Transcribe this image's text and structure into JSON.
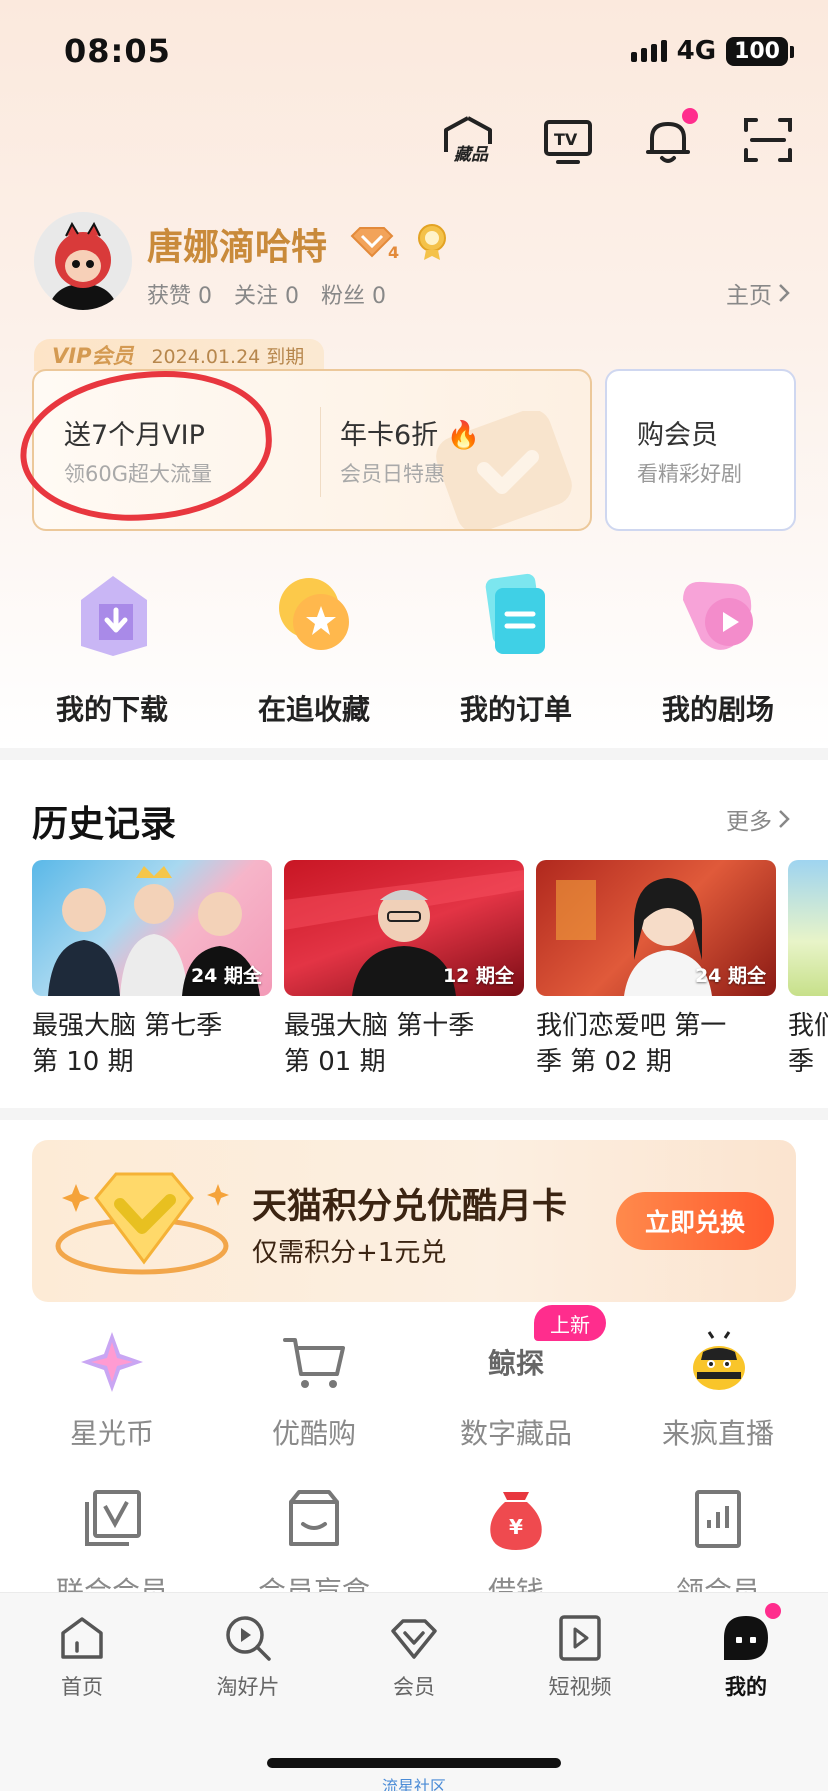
{
  "status": {
    "time": "08:05",
    "network": "4G",
    "battery": "100"
  },
  "top_icons": [
    {
      "name": "collection-icon",
      "label": "藏品"
    },
    {
      "name": "tv-cast-icon",
      "label": "TV"
    },
    {
      "name": "bell-icon"
    },
    {
      "name": "scan-icon"
    }
  ],
  "profile": {
    "username": "唐娜滴哈特",
    "level": "4",
    "stats": [
      "获赞 0",
      "关注 0",
      "粉丝 0"
    ],
    "homepage": "主页"
  },
  "vip": {
    "tag": "VIP会员",
    "expiry": "2024.01.24 到期",
    "offer1": {
      "main": "送7个月VIP",
      "sub": "领60G超大流量"
    },
    "offer2": {
      "main": "年卡6折",
      "sub": "会员日特惠"
    },
    "buy": {
      "main": "购会员",
      "sub": "看精彩好剧"
    }
  },
  "quick_actions": [
    "我的下载",
    "在追收藏",
    "我的订单",
    "我的剧场"
  ],
  "history": {
    "title": "历史记录",
    "more": "更多",
    "items": [
      {
        "episodes": "24 期全",
        "title_line1": "最强大脑 第七季",
        "title_line2": "第 10 期"
      },
      {
        "episodes": "12 期全",
        "title_line1": "最强大脑 第十季",
        "title_line2": "第 01 期"
      },
      {
        "episodes": "24 期全",
        "title_line1": "我们恋爱吧 第一",
        "title_line2": "季 第 02 期"
      },
      {
        "episodes": "",
        "title_line1": "我们",
        "title_line2": "季"
      }
    ]
  },
  "banner": {
    "title": "天猫积分兑优酷月卡",
    "subtitle": "仅需积分+1元兑",
    "button": "立即兑换"
  },
  "services_row1": [
    "星光币",
    "优酷购",
    "数字藏品",
    "来疯直播"
  ],
  "services_row2": [
    "联合会员",
    "会员盲盒",
    "借钱",
    "领会员"
  ],
  "new_badge": "上新",
  "digital_icon_text": "鲸探",
  "tabs": [
    "首页",
    "淘好片",
    "会员",
    "短视频",
    "我的"
  ],
  "watermark": "流星社区",
  "colors": {
    "accent_pink": "#ff2d8d",
    "gold": "#c98a3a",
    "annotation_red": "#e8373f"
  }
}
